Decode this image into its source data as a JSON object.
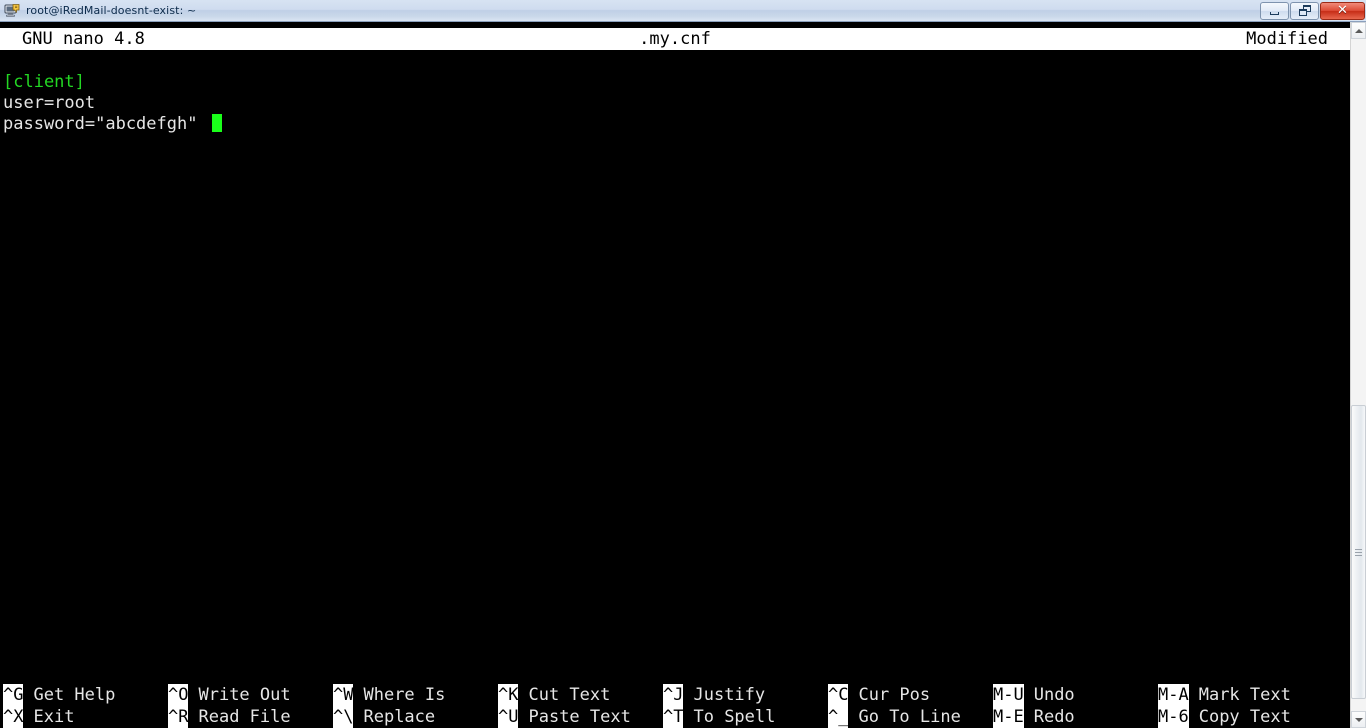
{
  "window": {
    "title": "root@iRedMail-doesnt-exist: ~",
    "icon": "putty-terminal-icon",
    "buttons": {
      "minimize": "Minimize",
      "restore": "Restore",
      "close": "Close"
    }
  },
  "editor": {
    "version": "GNU nano 4.8",
    "filename": ".my.cnf",
    "status": "Modified",
    "lines": [
      {
        "text": "[client]",
        "type": "section"
      },
      {
        "text": "user=root",
        "type": "plain"
      },
      {
        "text": "password=\"abcdefgh\"",
        "type": "plain"
      }
    ],
    "cursor": {
      "line": 3,
      "column": 20
    }
  },
  "shortcuts": {
    "row1": [
      {
        "key": "^G",
        "label": "Get Help"
      },
      {
        "key": "^O",
        "label": "Write Out"
      },
      {
        "key": "^W",
        "label": "Where Is"
      },
      {
        "key": "^K",
        "label": "Cut Text"
      },
      {
        "key": "^J",
        "label": "Justify"
      },
      {
        "key": "^C",
        "label": "Cur Pos"
      },
      {
        "key": "M-U",
        "label": "Undo"
      },
      {
        "key": "M-A",
        "label": "Mark Text"
      }
    ],
    "row2": [
      {
        "key": "^X",
        "label": "Exit"
      },
      {
        "key": "^R",
        "label": "Read File"
      },
      {
        "key": "^\\",
        "label": "Replace"
      },
      {
        "key": "^U",
        "label": "Paste Text"
      },
      {
        "key": "^T",
        "label": "To Spell"
      },
      {
        "key": "^_",
        "label": "Go To Line"
      },
      {
        "key": "M-E",
        "label": "Redo"
      },
      {
        "key": "M-6",
        "label": "Copy Text"
      }
    ]
  },
  "colors": {
    "terminal_background": "#000000",
    "terminal_foreground": "#e6e6e6",
    "section_highlight": "#23d723",
    "cursor": "#1aff1a",
    "inverse_background": "#ffffff",
    "inverse_foreground": "#000000"
  }
}
